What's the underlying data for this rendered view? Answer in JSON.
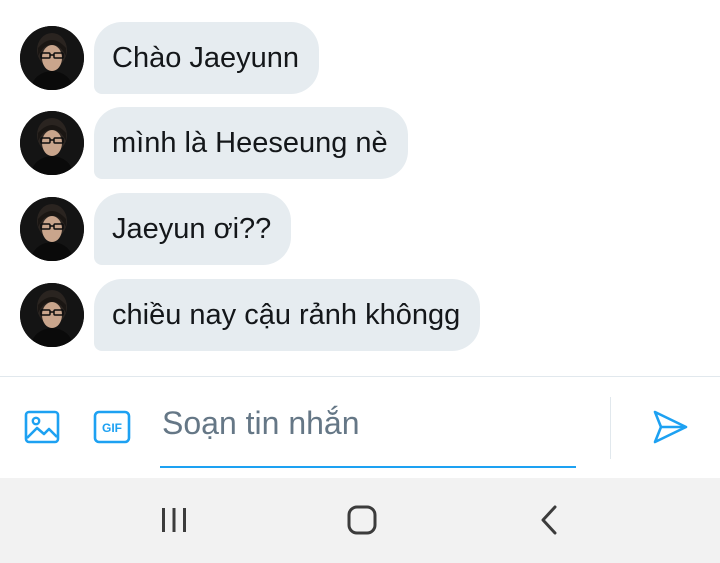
{
  "conversation": {
    "messages": [
      {
        "text": "Chào Jaeyunn"
      },
      {
        "text": "mình là Heeseung nè"
      },
      {
        "text": "Jaeyun ơi??"
      },
      {
        "text": "chiều nay cậu rảnh khôngg"
      }
    ]
  },
  "composer": {
    "placeholder": "Soạn tin nhắn",
    "gif_label": "GIF",
    "icons": {
      "image": "image-icon",
      "gif": "gif-icon",
      "send": "send-icon"
    }
  },
  "navigation": {
    "icons": [
      "recent-apps-icon",
      "home-icon",
      "back-icon"
    ]
  },
  "colors": {
    "accent": "#1da1f2",
    "bubble": "#e6ecf0",
    "text": "#14171a",
    "placeholder": "#657786",
    "navbar": "#f2f2f2"
  }
}
